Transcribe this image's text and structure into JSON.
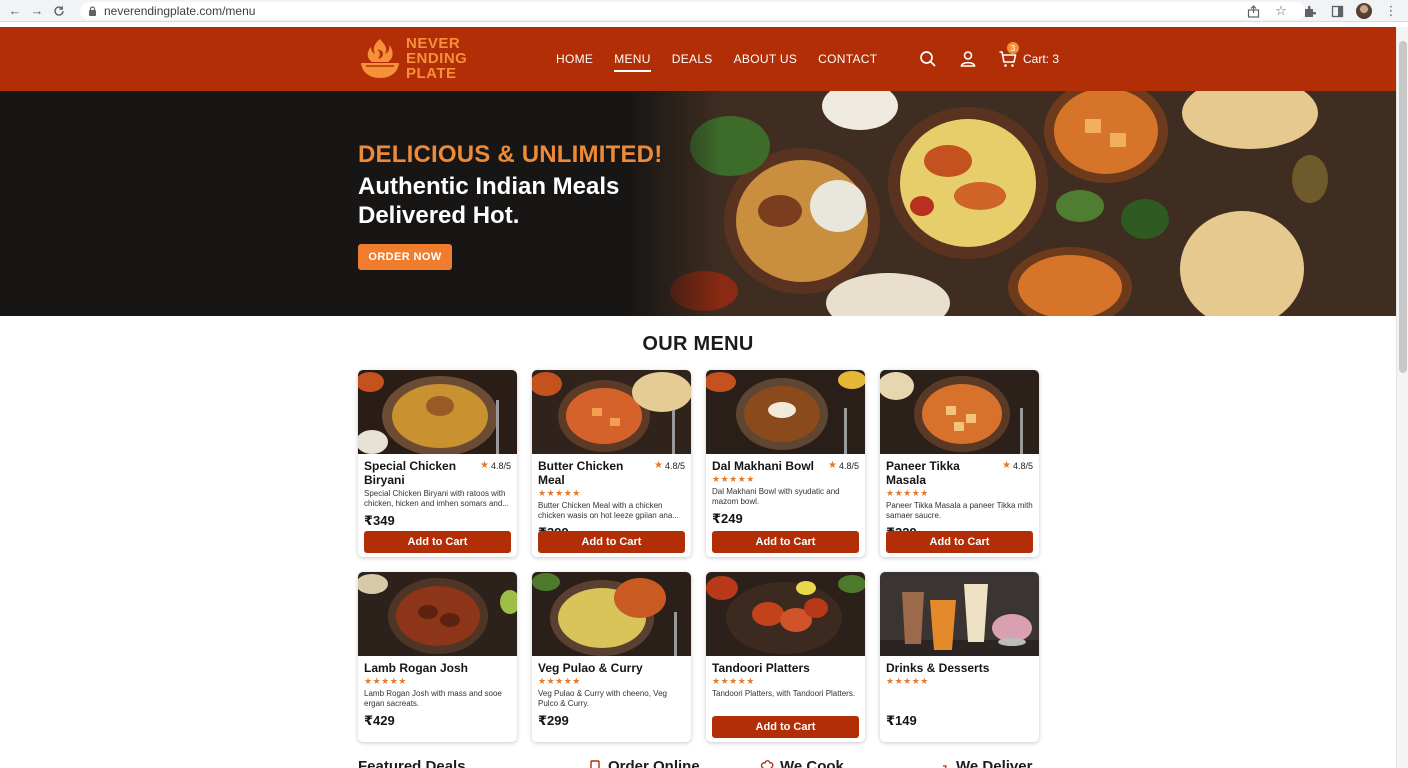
{
  "browser": {
    "url": "neverendingplate.com/menu",
    "back_icon": "arrow-left-icon",
    "forward_icon": "arrow-right-icon",
    "reload_icon": "reload-icon"
  },
  "header": {
    "brand_lines": [
      "NEVER",
      "ENDING",
      "PLATE"
    ],
    "nav": [
      "HOME",
      "MENU",
      "DEALS",
      "ABOUT US",
      "CONTACT"
    ],
    "active_nav": "MENU",
    "cart_count": "3",
    "cart_label": "Cart: 3"
  },
  "hero": {
    "tagline": "DELICIOUS & UNLIMITED!",
    "title_line1": "Authentic Indian Meals",
    "title_line2": "Delivered Hot.",
    "cta": "ORDER NOW"
  },
  "menu": {
    "title": "OUR MENU",
    "add_label": "Add to Cart",
    "items": [
      {
        "name": "Special Chicken Biryani",
        "rating": "4.8/5",
        "desc": "Special Chicken Biryani with ratoos with chicken, hicken and imhen somars and...",
        "price": "₹349",
        "stars": "★★★★★"
      },
      {
        "name": "Butter Chicken Meal",
        "rating": "4.8/5",
        "desc": "Butter Chicken Meal with a chicken chicken wasis on hot leeze gpiian ana...",
        "price": "₹399",
        "stars": "★★★★★"
      },
      {
        "name": "Dal Makhani Bowl",
        "rating": "4.8/5",
        "desc": "Dal Makhani Bowl with syudatic and mazom bowl.",
        "price": "₹249",
        "stars": "★★★★★"
      },
      {
        "name": "Paneer Tikka Masala",
        "rating": "4.8/5",
        "desc": "Paneer Tikka Masala a paneer Tikka mith samaer saucre.",
        "price": "₹329",
        "stars": "★★★★★"
      },
      {
        "name": "Lamb Rogan Josh",
        "rating": "",
        "desc": "Lamb Rogan Josh with mass and sooe ergan sacreats.",
        "price": "₹429",
        "stars": "★★★★★"
      },
      {
        "name": "Veg Pulao & Curry",
        "rating": "",
        "desc": "Veg Pulao & Curry with cheeno, Veg Pulco & Curry.",
        "price": "₹299",
        "stars": "★★★★★"
      },
      {
        "name": "Tandoori Platters",
        "rating": "",
        "desc": "Tandoori Platters, with Tandoori Platters.",
        "price": "",
        "stars": "★★★★★"
      },
      {
        "name": "Drinks & Desserts",
        "rating": "",
        "desc": "",
        "price": "₹149",
        "stars": "★★★★★"
      }
    ]
  },
  "footer_strip": {
    "featured": "Featured Deals",
    "order_online": "Order Online",
    "we_cook": "We Cook",
    "we_deliver": "We Deliver"
  },
  "colors": {
    "brand_red": "#b22e06",
    "accent_orange": "#f07d2e",
    "hero_bg": "#181615"
  }
}
